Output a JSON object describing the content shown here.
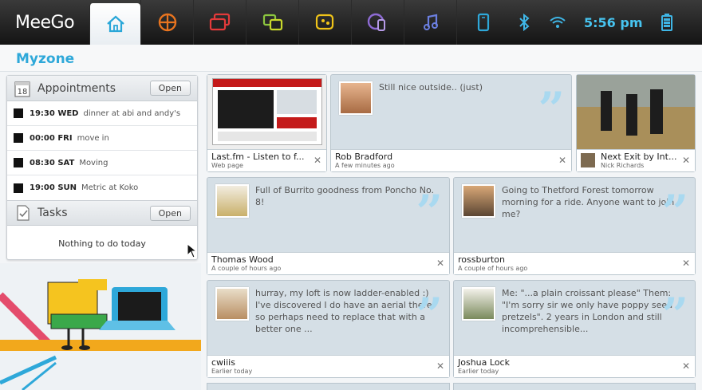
{
  "brand": "MeeGo",
  "status": {
    "time": "5:56 pm"
  },
  "toolbar_icons": [
    "home-icon",
    "applications-icon",
    "media-panel-icon",
    "people-icon",
    "chat-icon",
    "internet-icon",
    "music-icon",
    "devices-icon",
    "bluetooth-icon",
    "wifi-icon",
    "battery-icon"
  ],
  "page": {
    "title": "Myzone"
  },
  "appointments": {
    "header": "Appointments",
    "calendar_day": "18",
    "open_label": "Open",
    "items": [
      {
        "time": "19:30 WED",
        "desc": "dinner at abi and andy's"
      },
      {
        "time": "00:00 FRI",
        "desc": "move in"
      },
      {
        "time": "08:30 SAT",
        "desc": "Moving"
      },
      {
        "time": "19:00 SUN",
        "desc": "Metric at Koko"
      }
    ]
  },
  "tasks": {
    "header": "Tasks",
    "open_label": "Open",
    "empty": "Nothing to do today"
  },
  "cards": {
    "lastfm": {
      "name": "Last.fm - Listen to f...",
      "meta": "Web page"
    },
    "rob": {
      "message": "Still nice outside.. (just)",
      "name": "Rob Bradford",
      "meta": "A few minutes ago"
    },
    "nextexit": {
      "name": "Next Exit by Int...",
      "meta": "Nick Richards"
    },
    "thomas": {
      "message": "Full of Burrito goodness from Poncho No. 8!",
      "name": "Thomas Wood",
      "meta": "A couple of hours ago"
    },
    "ross": {
      "message": "Going to Thetford Forest tomorrow morning for a ride. Anyone want to join me?",
      "name": "rossburton",
      "meta": "A couple of hours ago"
    },
    "cwiiis": {
      "message": "hurray, my loft is now ladder-enabled :) I've discovered I do have an aerial there so perhaps need to replace that with a better one ...",
      "name": "cwiiis",
      "meta": "Earlier today"
    },
    "joshua": {
      "message": "Me: \"...a plain croissant please\" Them: \"I'm sorry sir we only have poppy seed pretzels\". 2 years in London and still incomprehensible...",
      "name": "Joshua Lock",
      "meta": "Earlier today"
    }
  },
  "colors": {
    "accent": "#2ea8d9",
    "card_bg": "#d5dfe6",
    "quote": "#a9d9f0"
  }
}
